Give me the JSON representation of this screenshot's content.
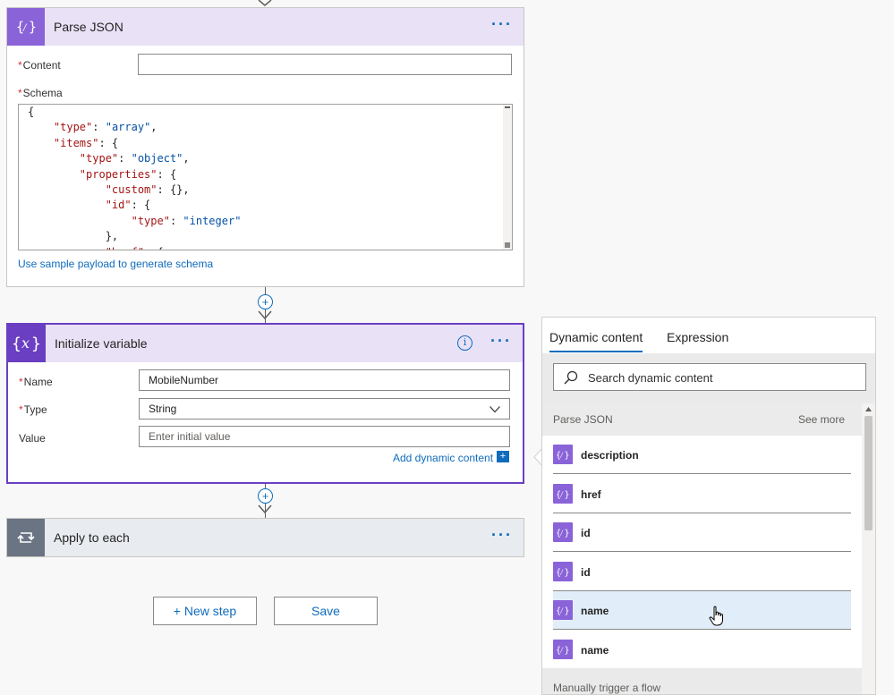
{
  "parse_json": {
    "title": "Parse JSON",
    "more": "···",
    "content_label": "Content",
    "content_value": "",
    "schema_label": "Schema",
    "schema_lines": [
      "{",
      "    \"type\": \"array\",",
      "    \"items\": {",
      "        \"type\": \"object\",",
      "        \"properties\": {",
      "            \"custom\": {},",
      "            \"id\": {",
      "                \"type\": \"integer\"",
      "            },",
      "            \"href\": {"
    ],
    "sample_link": "Use sample payload to generate schema",
    "required_mark": "*"
  },
  "init_variable": {
    "title": "Initialize variable",
    "more": "···",
    "info": "i",
    "name_label": "Name",
    "name_value": "MobileNumber",
    "type_label": "Type",
    "type_value": "String",
    "value_label": "Value",
    "value_placeholder": "Enter initial value",
    "add_dynamic": "Add dynamic content",
    "required_mark": "*"
  },
  "apply_each": {
    "title": "Apply to each",
    "more": "···"
  },
  "buttons": {
    "new_step": "+ New step",
    "save": "Save"
  },
  "dynamic_panel": {
    "tab_dynamic": "Dynamic content",
    "tab_expression": "Expression",
    "search_placeholder": "Search dynamic content",
    "section_title": "Parse JSON",
    "see_more": "See more",
    "items": [
      {
        "label": "description"
      },
      {
        "label": "href"
      },
      {
        "label": "id"
      },
      {
        "label": "id"
      },
      {
        "label": "name"
      },
      {
        "label": "name"
      }
    ],
    "next_section": "Manually trigger a flow"
  },
  "colors": {
    "accent": "#0f6cbd",
    "purple": "#8a63d8",
    "selected_border": "#6a3fc2",
    "hover_row": "#e1eef9"
  },
  "icons": {
    "parse_json": "curly-braces-icon",
    "variable": "variable-x-icon",
    "loop": "loop-icon",
    "search": "search-icon",
    "chevron": "chevron-down-icon",
    "add": "plus-circle-icon",
    "cursor": "hand-cursor-icon"
  }
}
